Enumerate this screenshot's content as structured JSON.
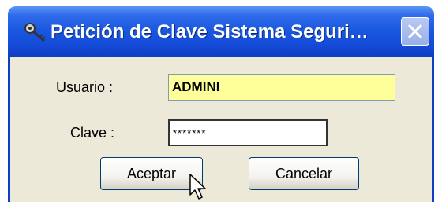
{
  "window": {
    "title": "Petición de Clave Sistema Seguri…",
    "close_label": "Close"
  },
  "form": {
    "user_label": "Usuario :",
    "user_value": "ADMINI",
    "pass_label": "Clave :",
    "pass_value": "*******"
  },
  "buttons": {
    "accept_label": "Aceptar",
    "cancel_label": "Cancelar"
  },
  "icons": {
    "title_icon": "key-icon",
    "close_icon": "close-icon",
    "cursor": "mouse-pointer-icon"
  },
  "colors": {
    "titlebar": "#1857e0",
    "body": "#ece9d8",
    "user_field_bg": "#ffff99"
  }
}
